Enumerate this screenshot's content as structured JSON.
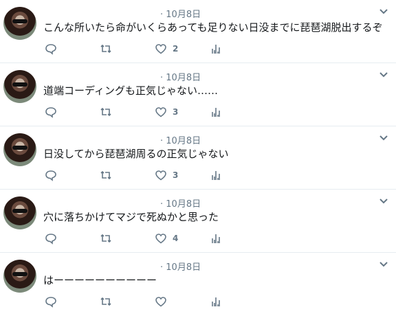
{
  "tweets": [
    {
      "date": "10月8日",
      "text": "こんな所いたら命がいくらあっても足りない日没までに琵琶湖脱出するぞ",
      "likes": "2"
    },
    {
      "date": "10月8日",
      "text": "道端コーディングも正気じゃない……",
      "likes": "3"
    },
    {
      "date": "10月8日",
      "text": "日没してから琵琶湖周るの正気じゃない",
      "likes": "3"
    },
    {
      "date": "10月8日",
      "text": "穴に落ちかけてマジで死ぬかと思った",
      "likes": "4"
    },
    {
      "date": "10月8日",
      "text": "はーーーーーーーーーー",
      "likes": ""
    }
  ],
  "meta_separator": "·",
  "icons": {
    "reply": "reply-icon",
    "retweet": "retweet-icon",
    "like": "heart-icon",
    "stats": "analytics-icon",
    "menu": "chevron-down-icon"
  },
  "colors": {
    "icon": "#657786",
    "divider": "#e6ecf0"
  }
}
